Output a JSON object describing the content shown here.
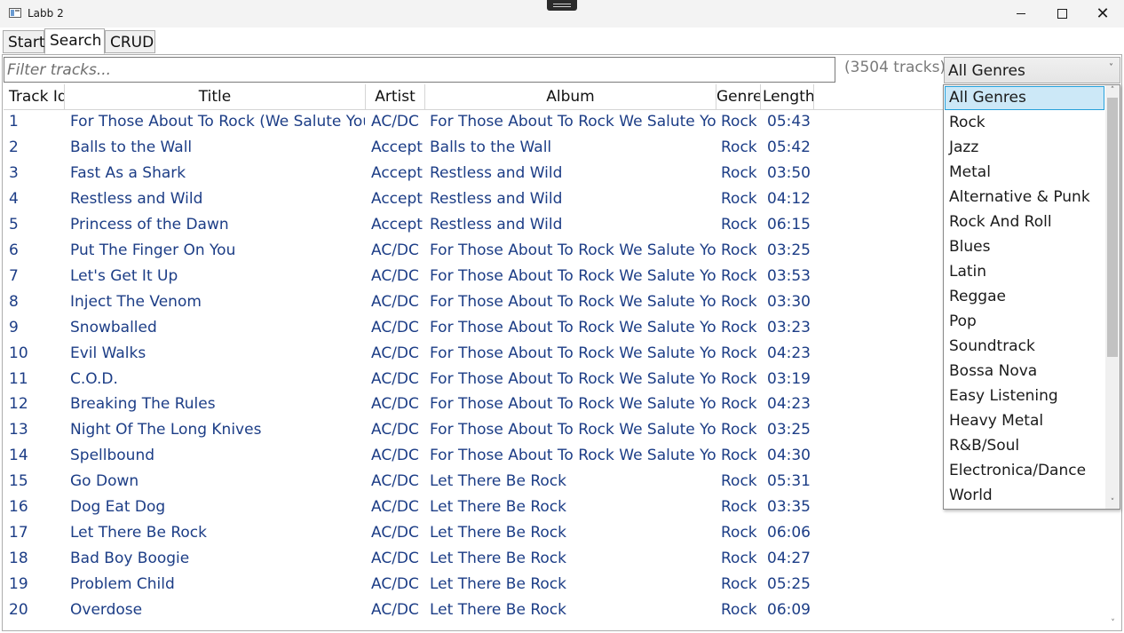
{
  "window": {
    "title": "Labb 2",
    "minimize_icon": "minimize-icon",
    "maximize_icon": "maximize-icon",
    "close_glyph": "✕"
  },
  "tabs": [
    {
      "label": "Start",
      "active": false
    },
    {
      "label": "Search",
      "active": true
    },
    {
      "label": "CRUD",
      "active": false
    }
  ],
  "search": {
    "placeholder": "Filter tracks...",
    "count_label": "(3504 tracks)",
    "genre_selected": "All Genres",
    "genre_chevron": "˅"
  },
  "grid": {
    "headers": [
      "Track Id",
      "Title",
      "Artist",
      "Album",
      "Genre",
      "Length"
    ],
    "rows": [
      [
        "1",
        "For Those About To Rock (We Salute You)",
        "AC/DC",
        "For Those About To Rock We Salute You",
        "Rock",
        "05:43"
      ],
      [
        "2",
        "Balls to the Wall",
        "Accept",
        "Balls to the Wall",
        "Rock",
        "05:42"
      ],
      [
        "3",
        "Fast As a Shark",
        "Accept",
        "Restless and Wild",
        "Rock",
        "03:50"
      ],
      [
        "4",
        "Restless and Wild",
        "Accept",
        "Restless and Wild",
        "Rock",
        "04:12"
      ],
      [
        "5",
        "Princess of the Dawn",
        "Accept",
        "Restless and Wild",
        "Rock",
        "06:15"
      ],
      [
        "6",
        "Put The Finger On You",
        "AC/DC",
        "For Those About To Rock We Salute You",
        "Rock",
        "03:25"
      ],
      [
        "7",
        "Let's Get It Up",
        "AC/DC",
        "For Those About To Rock We Salute You",
        "Rock",
        "03:53"
      ],
      [
        "8",
        "Inject The Venom",
        "AC/DC",
        "For Those About To Rock We Salute You",
        "Rock",
        "03:30"
      ],
      [
        "9",
        "Snowballed",
        "AC/DC",
        "For Those About To Rock We Salute You",
        "Rock",
        "03:23"
      ],
      [
        "10",
        "Evil Walks",
        "AC/DC",
        "For Those About To Rock We Salute You",
        "Rock",
        "04:23"
      ],
      [
        "11",
        "C.O.D.",
        "AC/DC",
        "For Those About To Rock We Salute You",
        "Rock",
        "03:19"
      ],
      [
        "12",
        "Breaking The Rules",
        "AC/DC",
        "For Those About To Rock We Salute You",
        "Rock",
        "04:23"
      ],
      [
        "13",
        "Night Of The Long Knives",
        "AC/DC",
        "For Those About To Rock We Salute You",
        "Rock",
        "03:25"
      ],
      [
        "14",
        "Spellbound",
        "AC/DC",
        "For Those About To Rock We Salute You",
        "Rock",
        "04:30"
      ],
      [
        "15",
        "Go Down",
        "AC/DC",
        "Let There Be Rock",
        "Rock",
        "05:31"
      ],
      [
        "16",
        "Dog Eat Dog",
        "AC/DC",
        "Let There Be Rock",
        "Rock",
        "03:35"
      ],
      [
        "17",
        "Let There Be Rock",
        "AC/DC",
        "Let There Be Rock",
        "Rock",
        "06:06"
      ],
      [
        "18",
        "Bad Boy Boogie",
        "AC/DC",
        "Let There Be Rock",
        "Rock",
        "04:27"
      ],
      [
        "19",
        "Problem Child",
        "AC/DC",
        "Let There Be Rock",
        "Rock",
        "05:25"
      ],
      [
        "20",
        "Overdose",
        "AC/DC",
        "Let There Be Rock",
        "Rock",
        "06:09"
      ]
    ]
  },
  "genre_dropdown": {
    "items": [
      "All Genres",
      "Rock",
      "Jazz",
      "Metal",
      "Alternative & Punk",
      "Rock And Roll",
      "Blues",
      "Latin",
      "Reggae",
      "Pop",
      "Soundtrack",
      "Bossa Nova",
      "Easy Listening",
      "Heavy Metal",
      "R&B/Soul",
      "Electronica/Dance",
      "World"
    ],
    "selected": "All Genres"
  },
  "colors": {
    "cell_text": "#1c3d86",
    "selected_bg": "#cce8f7",
    "selected_border": "#26a0da"
  },
  "scroll_glyphs": {
    "up": "˄",
    "down": "˅"
  }
}
